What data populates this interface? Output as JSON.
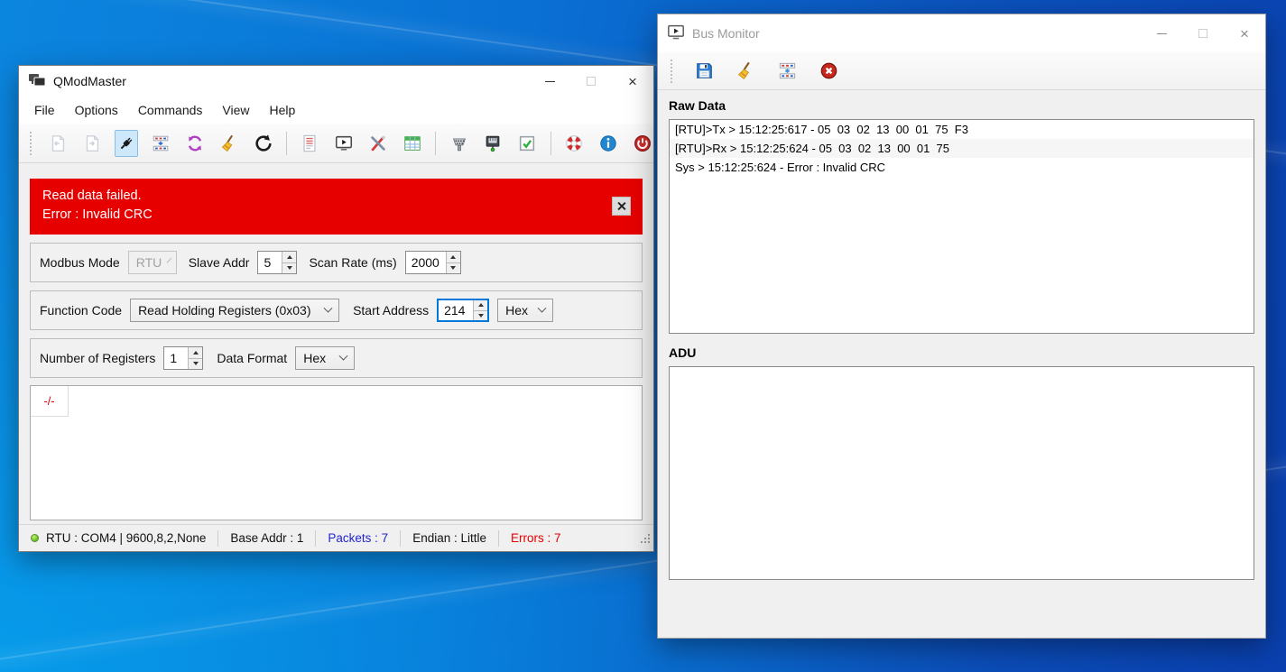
{
  "qmodmaster": {
    "window_title": "QModMaster",
    "menu": {
      "items": [
        "File",
        "Options",
        "Commands",
        "View",
        "Help"
      ]
    },
    "toolbar": {
      "icons": [
        "load-session",
        "save-session",
        "connect",
        "modbus-scan-rate",
        "scan-loop",
        "clear-data",
        "reset-counters",
        "open-log",
        "bus-monitor",
        "settings-tools",
        "registers-table",
        "serial-rtu-settings",
        "tcp-settings",
        "apply-settings",
        "about",
        "info",
        "exit"
      ],
      "selected": "connect"
    },
    "error_banner": {
      "line1": "Read data failed.",
      "line2": "Error : Invalid CRC"
    },
    "mode_row": {
      "modbus_mode_label": "Modbus Mode",
      "modbus_mode_value": "RTU",
      "slave_addr_label": "Slave Addr",
      "slave_addr_value": "5",
      "scan_rate_label": "Scan Rate (ms)",
      "scan_rate_value": "2000"
    },
    "function_row": {
      "function_code_label": "Function Code",
      "function_code_value": "Read Holding Registers (0x03)",
      "start_address_label": "Start Address",
      "start_address_value": "214",
      "address_base_value": "Hex"
    },
    "registers_row": {
      "num_registers_label": "Number of Registers",
      "num_registers_value": "1",
      "data_format_label": "Data Format",
      "data_format_value": "Hex"
    },
    "data_table": {
      "first_cell": "-/-"
    },
    "status_bar": {
      "connection": "RTU : COM4 | 9600,8,2,None",
      "base_addr": "Base Addr : 1",
      "packets": "Packets : 7",
      "endian": "Endian : Little",
      "errors": "Errors : 7"
    }
  },
  "bus_monitor": {
    "window_title": "Bus Monitor",
    "toolbar": {
      "icons": [
        "save-log",
        "clear-log",
        "scan-rate",
        "stop-monitor"
      ]
    },
    "raw_data": {
      "label": "Raw Data",
      "lines": [
        "[RTU]>Tx > 15:12:25:617 - 05  03  02  13  00  01  75  F3",
        "[RTU]>Rx > 15:12:25:624 - 05  03  02  13  00  01  75",
        "Sys > 15:12:25:624 - Error : Invalid CRC"
      ]
    },
    "adu": {
      "label": "ADU"
    }
  },
  "colors": {
    "error_banner_red": "#e60000",
    "packets_blue": "#2323cd",
    "errors_red": "#e60000",
    "focus_accent": "#0078d7",
    "selected_tool_bg": "#cde8fb",
    "desktop_blue_left": "#0b86df",
    "desktop_blue_right": "#0a40b0"
  }
}
